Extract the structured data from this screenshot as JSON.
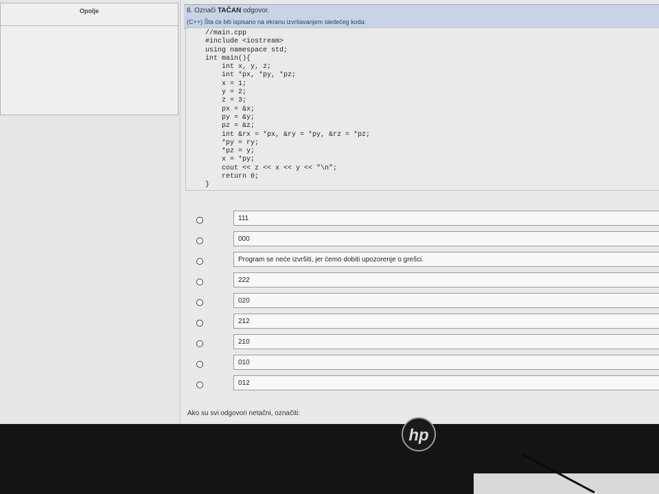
{
  "sidebar": {
    "header_label": "Opolje"
  },
  "question": {
    "title_prefix": "8. Označi",
    "title_emphasis": "TAČAN",
    "title_suffix": "odgovor.",
    "subtitle": "(C++) Šta će biti ispisano na ekranu izvršavanjem sledećeg koda:"
  },
  "code_lines": [
    "//main.cpp",
    "#include <iostream>",
    "using namespace std;",
    "int main(){",
    "    int x, y, z;",
    "    int *px, *py, *pz;",
    "    x = 1;",
    "    y = 2;",
    "    z = 3;",
    "    px = &x;",
    "    py = &y;",
    "    pz = &z;",
    "    int &rx = *px, &ry = *py, &rz = *pz;",
    "    *py = ry;",
    "    *pz = y;",
    "    x = *py;",
    "    cout << z << x << y << \"\\n\";",
    "    return 0;",
    "}"
  ],
  "answers": [
    "111",
    "000",
    "Program se neće izvršiti, jer ćemo dobiti upozorenje o grešci.",
    "222",
    "020",
    "212",
    "210",
    "010",
    "012"
  ],
  "footer_text": "Ako su svi odgovori netačni, označiti:",
  "brand": {
    "logo_text": "hp"
  }
}
